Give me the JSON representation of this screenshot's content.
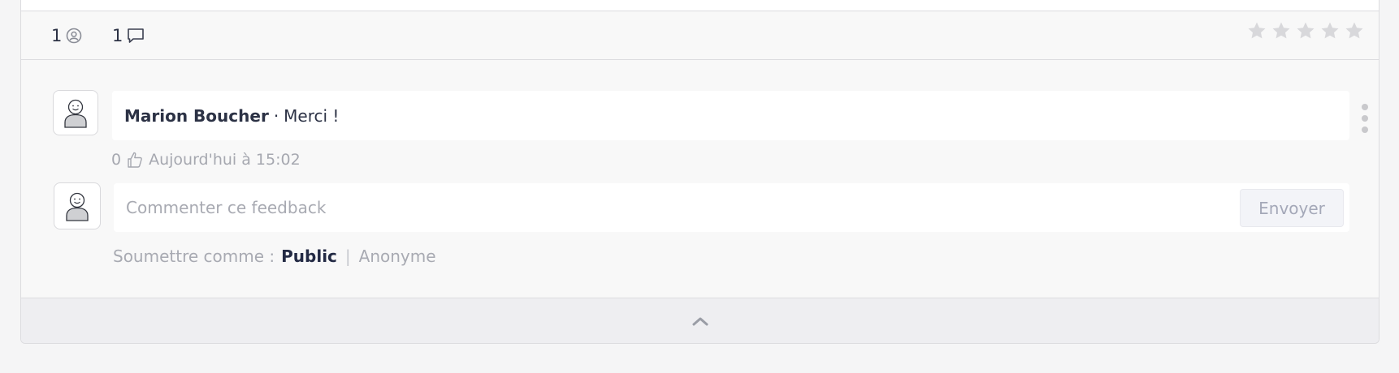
{
  "stats": {
    "followers_count": "1",
    "comments_count": "1",
    "followers_icon": "user-circle-icon",
    "comments_icon": "speech-bubble-icon"
  },
  "rating": {
    "stars_total": 5,
    "stars_filled": 0,
    "star_color": "#d8d8db"
  },
  "comment": {
    "author": "Marion Boucher",
    "separator": "·",
    "text": "Merci !",
    "likes": "0",
    "like_icon": "thumbs-up-icon",
    "timestamp": "Aujourd'hui à 15:02",
    "menu_icon": "more-vertical-icon"
  },
  "composer": {
    "placeholder": "Commenter ce feedback",
    "send_label": "Envoyer"
  },
  "submit_as": {
    "label": "Soumettre comme :",
    "public_label": "Public",
    "divider": "|",
    "anonymous_label": "Anonyme",
    "selected": "Public"
  },
  "footer": {
    "collapse_icon": "chevron-up-icon"
  },
  "colors": {
    "text_primary": "#2c3245",
    "text_muted": "#a6a8b0",
    "border": "#dcdcdf",
    "card_bg": "#f8f8f8"
  }
}
